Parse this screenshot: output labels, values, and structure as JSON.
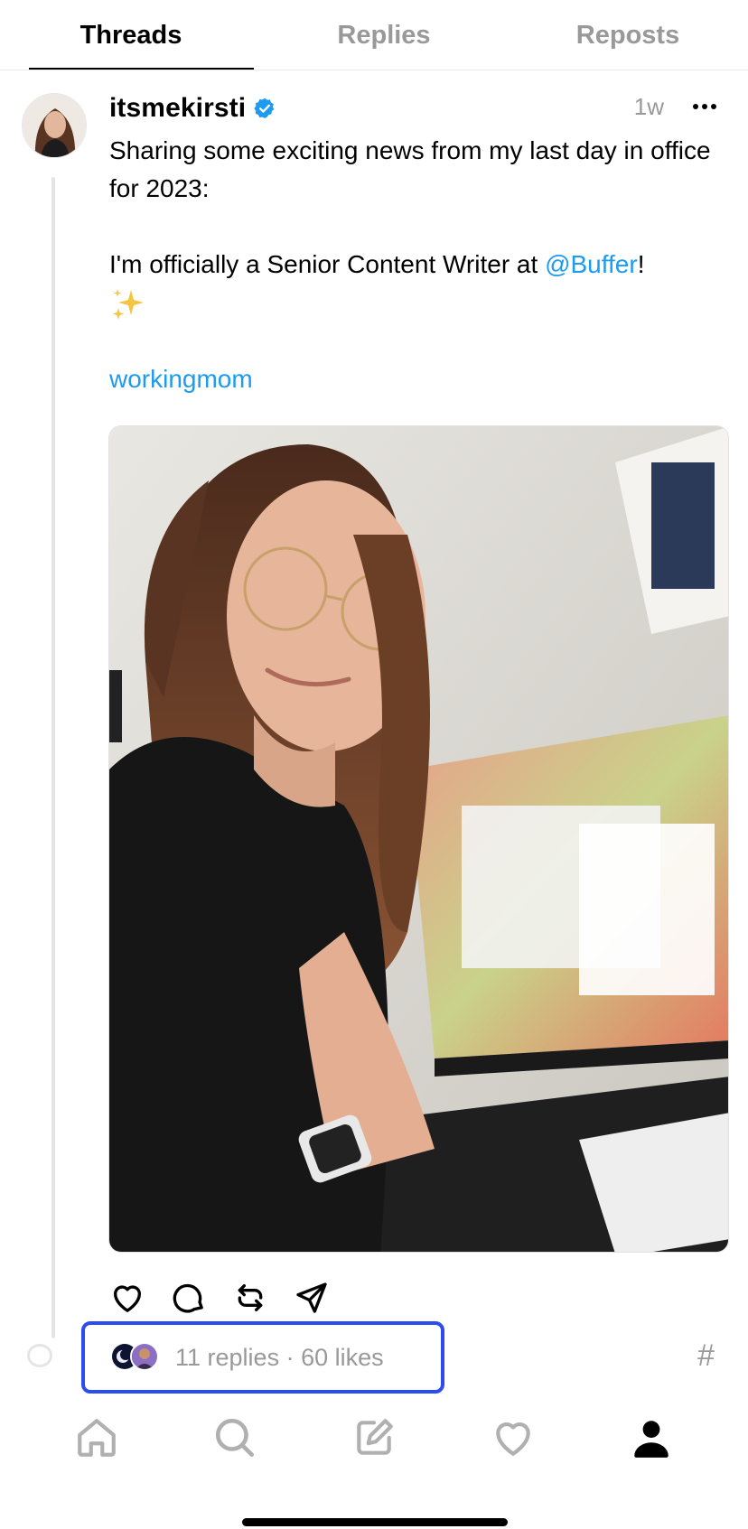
{
  "tabs": [
    {
      "label": "Threads",
      "active": true
    },
    {
      "label": "Replies",
      "active": false
    },
    {
      "label": "Reposts",
      "active": false
    }
  ],
  "post": {
    "username": "itsmekirsti",
    "verified": true,
    "timestamp": "1w",
    "text_line1": "Sharing some exciting news from my last day in office for 2023:",
    "text_line2_prefix": "I'm officially a Senior Content Writer at ",
    "mention": "@Buffer",
    "text_line2_suffix": "!",
    "emoji": "sparkles",
    "hashtag": "workingmom",
    "photo_description_icon": "selfie-photo"
  },
  "stats": {
    "replies": "11 replies",
    "separator": " · ",
    "likes": "60 likes"
  },
  "icons": {
    "hash": "#"
  },
  "colors": {
    "link": "#1d9bf0",
    "muted": "#999999",
    "highlight_box": "#2b4cf0",
    "verified": "#1d9bf0"
  }
}
